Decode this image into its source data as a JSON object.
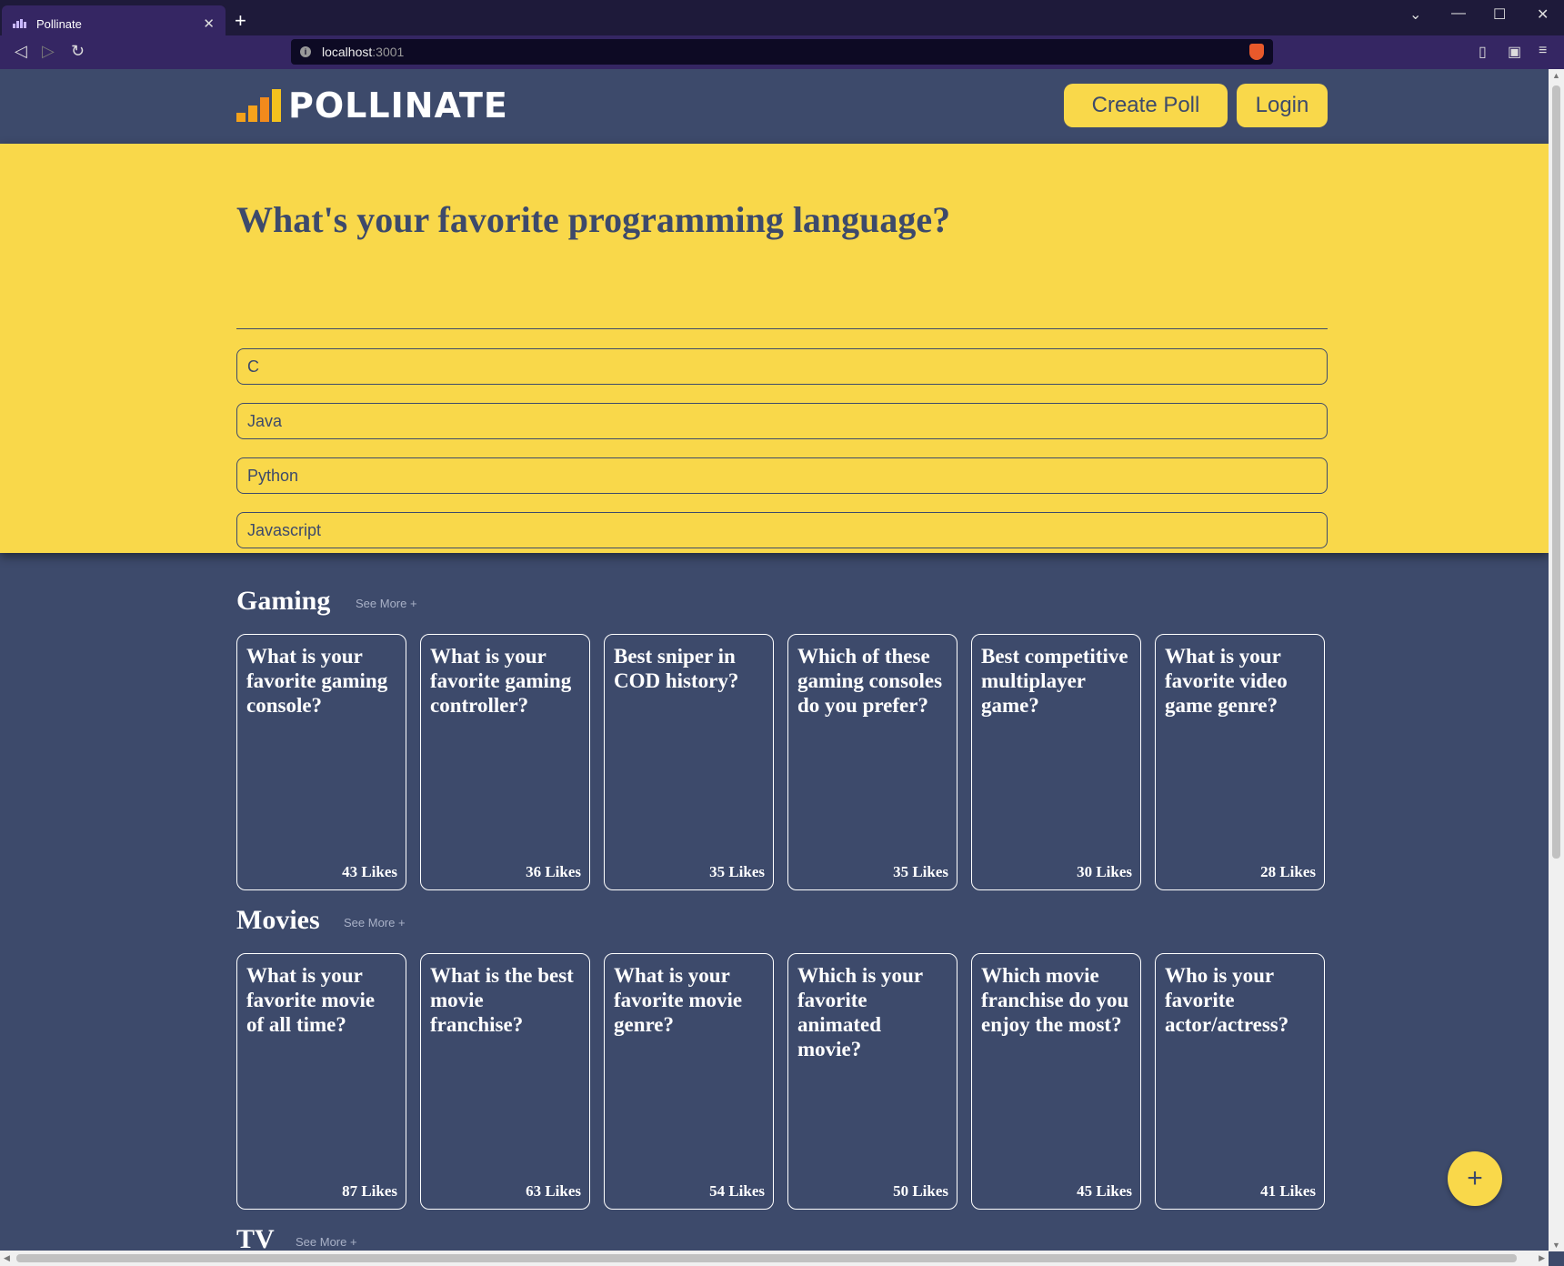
{
  "browser": {
    "tab_title": "Pollinate",
    "tab_close": "✕",
    "new_tab": "+",
    "url_host": "localhost",
    "url_port": ":3001",
    "win_minimize": "—",
    "win_maximize": "☐",
    "win_close": "✕",
    "win_dropdown": "⌄"
  },
  "header": {
    "logo_text": "POLLINATE",
    "create_poll_label": "Create Poll",
    "login_label": "Login"
  },
  "featured_poll": {
    "question": "What's your favorite programming language?",
    "options": [
      "C",
      "Java",
      "Python",
      "Javascript"
    ]
  },
  "categories": [
    {
      "title": "Gaming",
      "see_more": "See More +",
      "polls": [
        {
          "question": "What is your favorite gaming console?",
          "likes": "43 Likes"
        },
        {
          "question": "What is your favorite gaming controller?",
          "likes": "36 Likes"
        },
        {
          "question": "Best sniper in COD history?",
          "likes": "35 Likes"
        },
        {
          "question": "Which of these gaming consoles do you prefer?",
          "likes": "35 Likes"
        },
        {
          "question": "Best competitive multiplayer game?",
          "likes": "30 Likes"
        },
        {
          "question": "What is your favorite video game genre?",
          "likes": "28 Likes"
        }
      ]
    },
    {
      "title": "Movies",
      "see_more": "See More +",
      "polls": [
        {
          "question": "What is your favorite movie of all time?",
          "likes": "87 Likes"
        },
        {
          "question": "What is the best movie franchise?",
          "likes": "63 Likes"
        },
        {
          "question": "What is your favorite movie genre?",
          "likes": "54 Likes"
        },
        {
          "question": "Which is your favorite animated movie?",
          "likes": "50 Likes"
        },
        {
          "question": "Which movie franchise do you enjoy the most?",
          "likes": "45 Likes"
        },
        {
          "question": "Who is your favorite actor/actress?",
          "likes": "41 Likes"
        }
      ]
    },
    {
      "title": "TV",
      "see_more": "See More +"
    }
  ],
  "fab_label": "+",
  "colors": {
    "brand_yellow": "#f9d84a",
    "page_navy": "#3d4a6b",
    "browser_purple": "#352663"
  }
}
